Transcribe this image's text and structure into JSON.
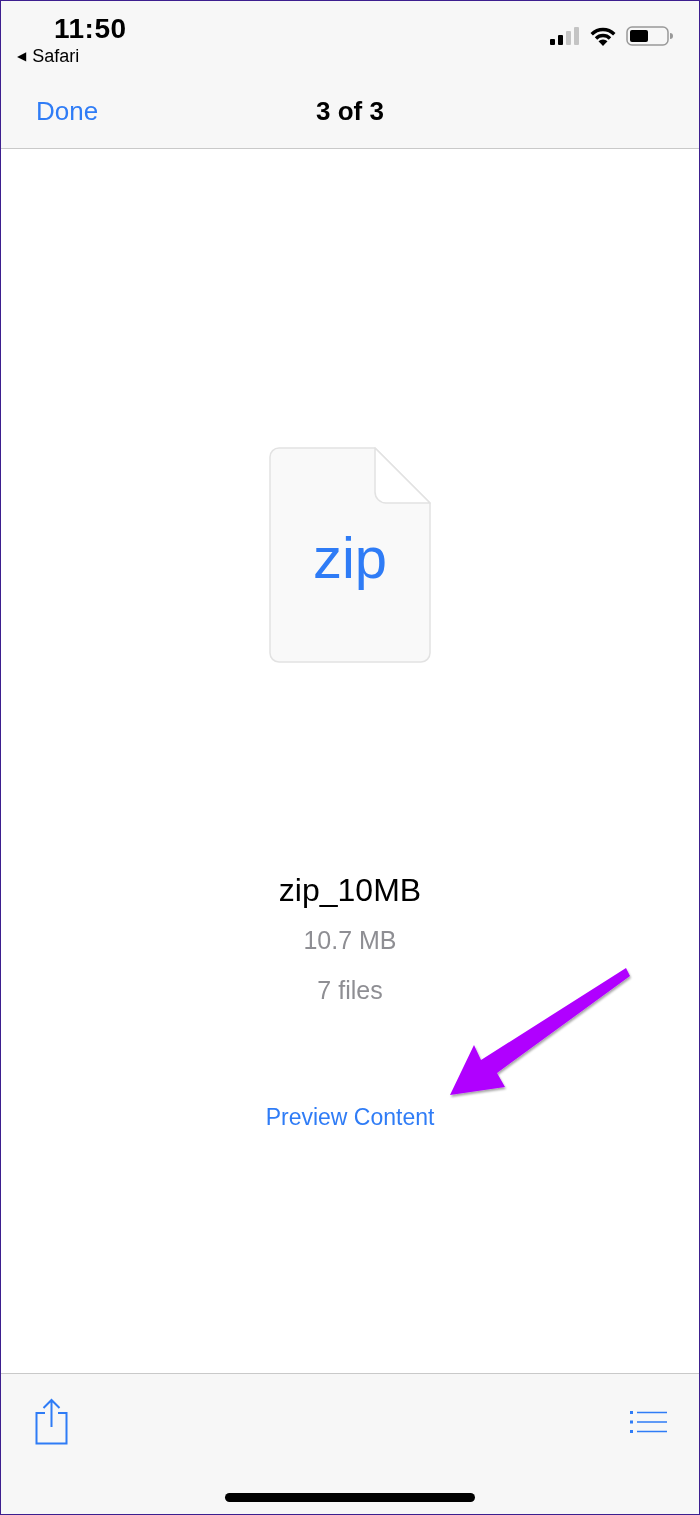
{
  "status_bar": {
    "time": "11:50",
    "back_arrow": "◀",
    "back_app": "Safari"
  },
  "nav_bar": {
    "done_button": "Done",
    "title": "3 of 3"
  },
  "file": {
    "icon_label": "zip",
    "name": "zip_10MB",
    "size": "10.7 MB",
    "file_count": "7 files",
    "action": "Preview Content"
  },
  "annotations": [
    {
      "kind": "arrow"
    }
  ]
}
